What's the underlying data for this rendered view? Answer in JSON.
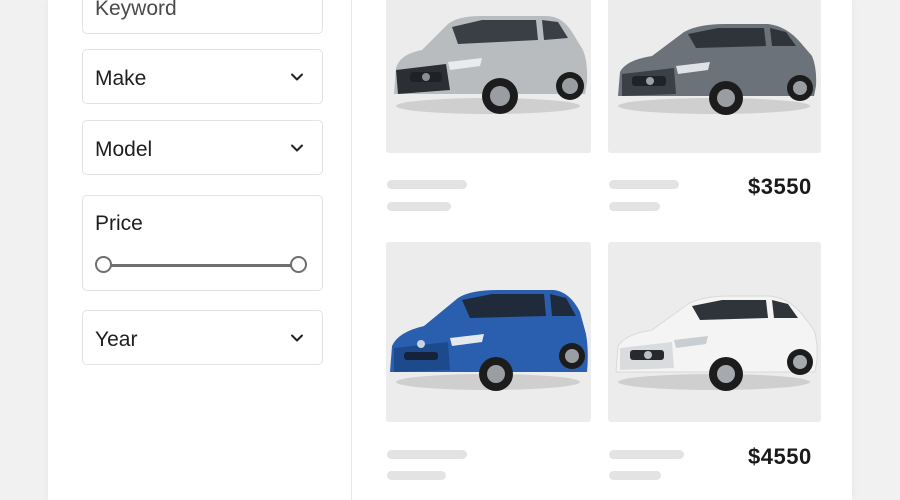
{
  "filters": {
    "keyword": {
      "placeholder": "Keyword"
    },
    "make": {
      "label": "Make"
    },
    "model": {
      "label": "Model"
    },
    "price": {
      "label": "Price",
      "range_min_fraction": 0.0,
      "range_max_fraction": 1.0
    },
    "year": {
      "label": "Year"
    }
  },
  "listings": [
    {
      "color": "#b9bcbf",
      "price": ""
    },
    {
      "color": "#6b7279",
      "price": "$3550"
    },
    {
      "color": "#2a5fb0",
      "price": ""
    },
    {
      "color": "#f4f4f4",
      "price": "$4550"
    }
  ],
  "colors": {
    "page_bg": "#f1f1f1",
    "panel_bg": "#ffffff",
    "border": "#e2e2e2",
    "placeholder_bar": "#e3e3e3",
    "image_bg": "#ececec"
  }
}
